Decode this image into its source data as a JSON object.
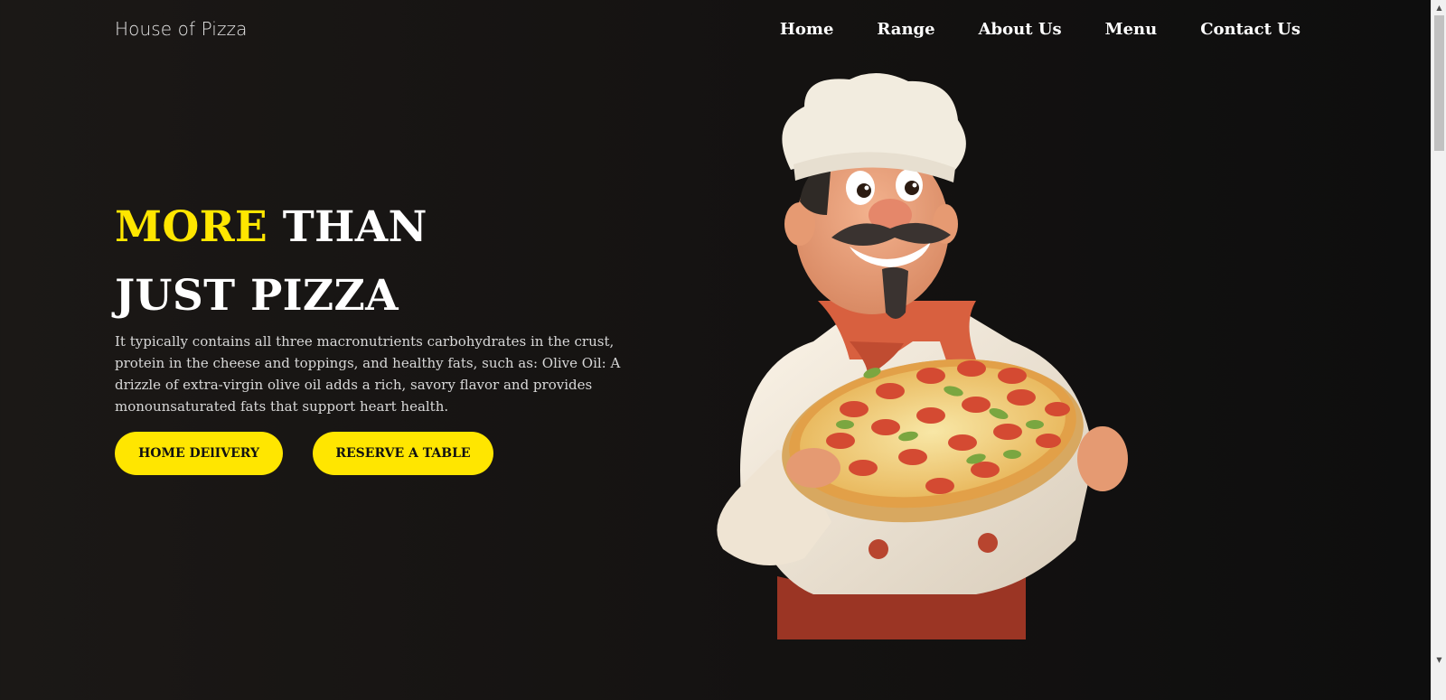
{
  "header": {
    "brand": "House of Pizza",
    "nav": [
      "Home",
      "Range",
      "About Us",
      "Menu",
      "Contact Us"
    ]
  },
  "hero": {
    "title_accent": "MORE",
    "title_rest": "THAN",
    "title_line2": "JUST PIZZA",
    "description": "It typically contains all three macronutrients carbohydrates in the crust, protein in the cheese and toppings, and healthy fats, such as: Olive Oil: A drizzle of extra-virgin olive oil adds a rich, savory flavor and provides monounsaturated fats that support heart health.",
    "buttons": {
      "delivery": "HOME DElIVERY",
      "reserve": "RESERVE A TABLE"
    }
  },
  "colors": {
    "accent": "#ffe600",
    "background": "#141211",
    "text": "#ffffff"
  },
  "icons": {
    "scroll_up": "triangle-up-icon",
    "scroll_down": "triangle-down-icon"
  }
}
